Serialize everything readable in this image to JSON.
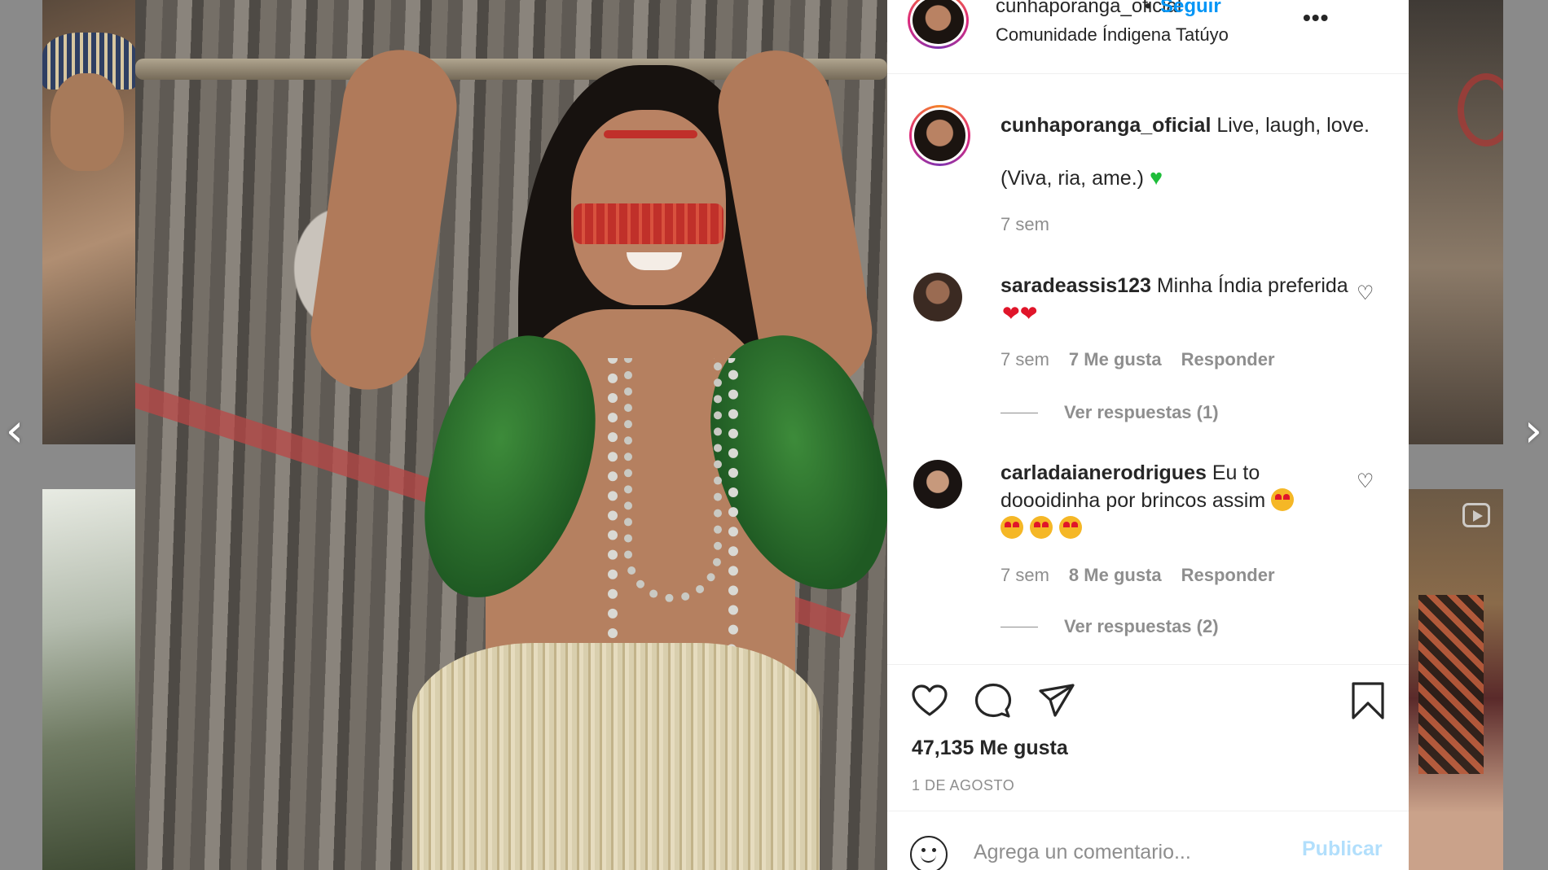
{
  "navigation": {
    "prev_glyph": "‹",
    "next_glyph": "›"
  },
  "post": {
    "username": "cunhaporanga_oficial",
    "separator": "•",
    "follow_label": "Seguir",
    "location": "Comunidade Índigena Tatúyo",
    "more_glyph": "•••",
    "caption": {
      "username": "cunhaporanga_oficial",
      "text": "Live, laugh, love.",
      "line2": "(Viva, ria, ame.)",
      "emoji": "♥",
      "time": "7 sem"
    },
    "comments": [
      {
        "username": "saradeassis123",
        "text": "Minha Índia preferida",
        "emoji": "❤❤",
        "time": "7 sem",
        "likes": "7 Me gusta",
        "reply": "Responder",
        "view_replies": "Ver respuestas (1)"
      },
      {
        "username": "carladaianerodrigues",
        "text": "Eu to doooidinha por brincos assim",
        "time": "7 sem",
        "likes": "8 Me gusta",
        "reply": "Responder",
        "view_replies": "Ver respuestas (2)"
      }
    ],
    "likes_count": "47,135 Me gusta",
    "date": "1 DE AGOSTO",
    "comment_input": {
      "placeholder": "Agrega un comentario...",
      "value": ""
    },
    "publish_label": "Publicar"
  },
  "colors": {
    "link_blue": "#0095f6",
    "publish_disabled": "#b2dffc",
    "muted_text": "#8e8e8e",
    "heart_green": "#1ebd3a",
    "heart_red": "#e0152a"
  },
  "icons": [
    "chevron-left-icon",
    "chevron-right-icon",
    "more-options-icon",
    "heart-icon",
    "comment-icon",
    "share-icon",
    "bookmark-icon",
    "emoji-icon",
    "reels-icon"
  ]
}
